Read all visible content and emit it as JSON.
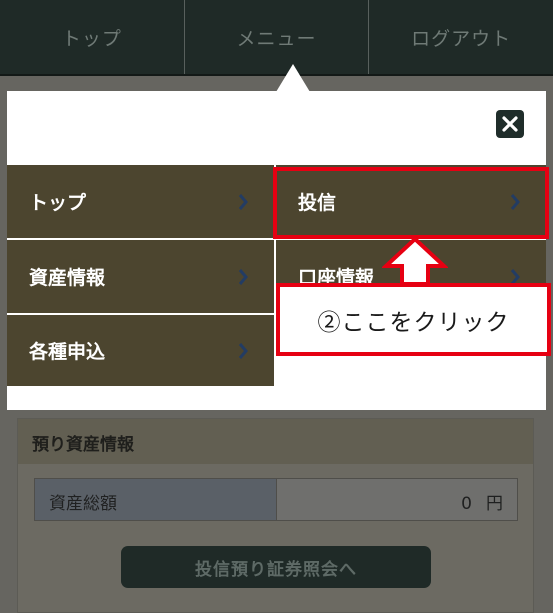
{
  "topnav": {
    "items": [
      {
        "label": "トップ"
      },
      {
        "label": "メニュー"
      },
      {
        "label": "ログアウト"
      }
    ]
  },
  "menu": {
    "items": [
      {
        "label": "トップ"
      },
      {
        "label": "投信"
      },
      {
        "label": "資産情報"
      },
      {
        "label": "口座情報"
      },
      {
        "label": "各種申込"
      }
    ]
  },
  "assets": {
    "header": "預り資産情報",
    "total_label": "資産総額",
    "total_value": "0",
    "total_unit": "円",
    "button_label": "投信預り証券照会へ"
  },
  "annotation": {
    "callout_text": "②ここをクリック"
  },
  "colors": {
    "nav_bg": "#1f2a27",
    "menu_tile": "#4c452f",
    "highlight_red": "#e60012"
  }
}
